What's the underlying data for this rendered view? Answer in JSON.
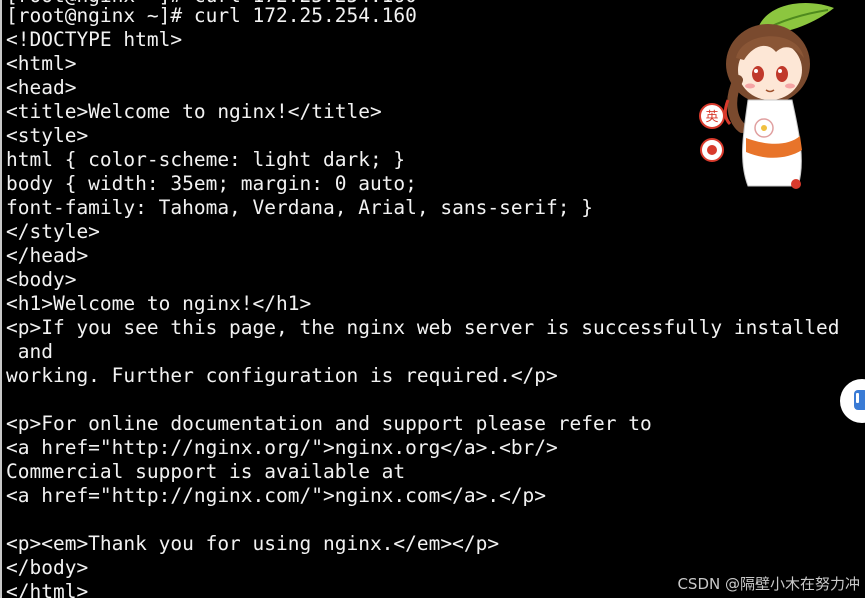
{
  "terminal": {
    "top_partial": "[root@nginx ~]# curl 172.25.254.160",
    "lines": [
      "[root@nginx ~]# curl 172.25.254.160",
      "<!DOCTYPE html>",
      "<html>",
      "<head>",
      "<title>Welcome to nginx!</title>",
      "<style>",
      "html { color-scheme: light dark; }",
      "body { width: 35em; margin: 0 auto;",
      "font-family: Tahoma, Verdana, Arial, sans-serif; }",
      "</style>",
      "</head>",
      "<body>",
      "<h1>Welcome to nginx!</h1>",
      "<p>If you see this page, the nginx web server is successfully installed",
      " and",
      "working. Further configuration is required.</p>",
      "",
      "<p>For online documentation and support please refer to",
      "<a href=\"http://nginx.org/\">nginx.org</a>.<br/>",
      "Commercial support is available at",
      "<a href=\"http://nginx.com/\">nginx.com</a>.</p>",
      "",
      "<p><em>Thank you for using nginx.</em></p>",
      "</body>",
      "</html>"
    ]
  },
  "mascot": {
    "badge_top": "英",
    "icon": "anime-girl-mascot-icon"
  },
  "watermark": "CSDN @隔壁小木在努力冲",
  "colors": {
    "background": "#000000",
    "text": "#f2f2f2",
    "watermark": "#c9c9c9",
    "accent_red": "#d83a2c",
    "float_blue": "#3a7bd5"
  }
}
